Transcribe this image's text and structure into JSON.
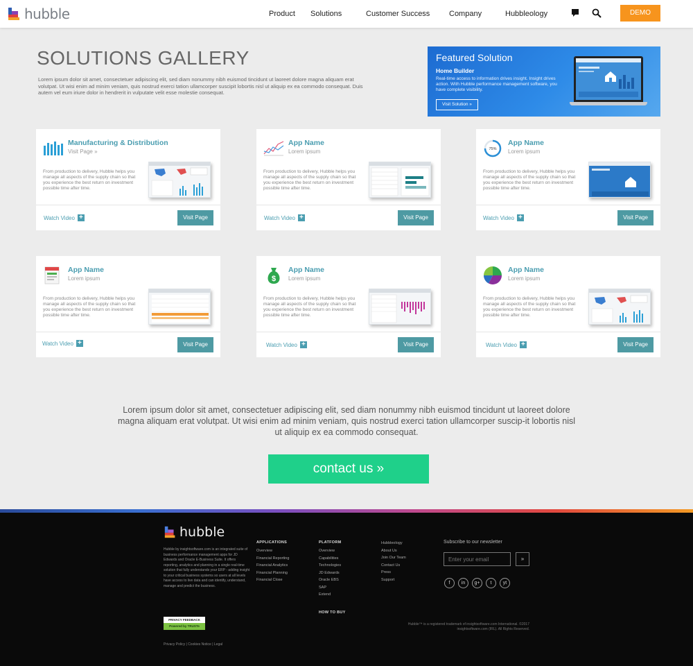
{
  "header": {
    "logo_text": "hubble",
    "nav": [
      "Product",
      "Solutions",
      "Customer Success",
      "Company",
      "Hubbleology"
    ],
    "demo_label": "DEMO",
    "icons": [
      "chat-icon",
      "search-icon"
    ]
  },
  "page": {
    "title": "SOLUTIONS GALLERY",
    "intro": "Lorem ipsum dolor sit amet, consectetuer adipiscing elit, sed diam nonummy nibh euismod tincidunt ut laoreet dolore magna aliquam erat volutpat. Ut wisi enim ad minim veniam, quis nostrud exerci tation ullamcorper suscipit lobortis nisl ut aliquip ex ea commodo consequat. Duis autem vel eum iriure dolor in hendrerit in vulputate velit esse molestie consequat."
  },
  "featured": {
    "heading": "Featured Solution",
    "name": "Home Builder",
    "description": "Real-time access to information drives insight. Insight drives action. With Hubble performance management software, you have complete visibility.",
    "button": "Visit Solution »"
  },
  "cards": [
    {
      "title": "Manufacturing & Distribution",
      "subtitle": "Visit Page »",
      "icon": "bar-chart-icon",
      "description": "From production to delivery, Hubble helps you manage all aspects of the supply chain so that you experience the best return on investment possible time after time.",
      "watch": "Watch Video",
      "visit": "Visit Page"
    },
    {
      "title": "App Name",
      "subtitle": "Lorem ipsum",
      "icon": "line-chart-icon",
      "description": "From production to delivery, Hubble helps you manage all aspects of the supply chain so that you experience the best return on investment possible time after time.",
      "watch": "Watch Video",
      "visit": "Visit Page"
    },
    {
      "title": "App Name",
      "subtitle": "Lorem ipsum",
      "icon": "gauge-icon",
      "gauge_label": "75%",
      "gauge_value": 0.75,
      "description": "From production to delivery, Hubble helps you manage all aspects of the supply chain so that you experience the best return on investment possible time after time.",
      "watch": "Watch Video",
      "visit": "Visit Page"
    },
    {
      "title": "App Name",
      "subtitle": "Lorem ipsum",
      "icon": "report-icon",
      "description": "From production to delivery, Hubble helps you manage all aspects of the supply chain so that you experience the best return on investment possible time after time.",
      "watch": "Watch Video",
      "visit": "Visit Page"
    },
    {
      "title": "App Name",
      "subtitle": "Lorem ipsum",
      "icon": "money-bag-icon",
      "description": "From production to delivery, Hubble helps you manage all aspects of the supply chain so that you experience the best return on investment possible time after time.",
      "watch": "Watch Video",
      "visit": "Visit Page"
    },
    {
      "title": "App Name",
      "subtitle": "Lorem ipsum",
      "icon": "pie-chart-icon",
      "description": "From production to delivery, Hubble helps you manage all aspects of the supply chain so that you experience the best return on investment possible time after time.",
      "watch": "Watch Video",
      "visit": "Visit Page"
    }
  ],
  "cta": {
    "text": "Lorem ipsum dolor sit amet, consectetuer adipiscing elit, sed diam nonummy nibh euismod tincidunt ut laoreet dolore magna aliquam erat volutpat. Ut wisi enim ad minim veniam, quis nostrud exerci tation ullamcorper suscip-it lobortis nisl ut aliquip ex ea commodo consequat.",
    "button": "contact us »"
  },
  "footer": {
    "logo_text": "hubble",
    "about": "Hubble by insightsoftware.com is an integrated suite of business performance management apps for JD Edwards and Oracle E-Business Suite. It offers reporting, analytics and planning in a single real-time solution that fully understands your ERP - adding insight to your critical business systems so users at all levels have access to live data and can identify, understand, manage and predict the business.",
    "applications": {
      "heading": "APPLICATIONS",
      "items": [
        "Overview",
        "Financial Reporting",
        "Financial Analytics",
        "Financial Planning",
        "Financial Close"
      ]
    },
    "platform": {
      "heading": "PLATFORM",
      "items": [
        "Overview",
        "Capabilities",
        "Technologies",
        "JD Edwards",
        "Oracle EBS",
        "SAP",
        "Extend"
      ]
    },
    "how_to_buy": "HOW TO BUY",
    "company_links": [
      "Hubbleology",
      "About Us",
      "Join Our Team",
      "Contact Us",
      "Press",
      "Support"
    ],
    "newsletter_label": "Subscribe to our newsletter",
    "email_placeholder": "Enter your email",
    "submit": "»",
    "social": [
      "f",
      "in",
      "g+",
      "t",
      "yt"
    ],
    "trust_top": "PRIVACY FEEDBACK",
    "trust_bottom": "Powered by TRUSTe",
    "legal": "Privacy Policy | Cookies Notice | Legal",
    "copyright": "Hubble™ is a registered trademark of insightsoftware.com International. ©2017 insightsoftware.com (IRL). All Rights Reserved."
  }
}
